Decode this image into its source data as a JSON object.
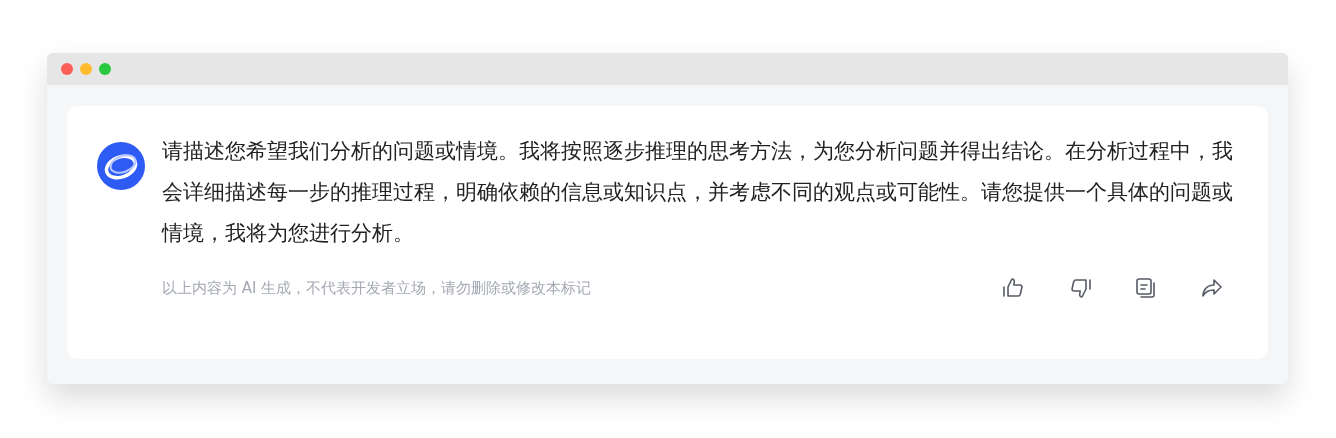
{
  "message": {
    "text": "请描述您希望我们分析的问题或情境。我将按照逐步推理的思考方法，为您分析问题并得出结论。在分析过程中，我会详细描述每一步的推理过程，明确依赖的信息或知识点，并考虑不同的观点或可能性。请您提供一个具体的问题或情境，我将为您进行分析。"
  },
  "disclaimer": "以上内容为 AI 生成，不代表开发者立场，请勿删除或修改本标记",
  "actions": [
    {
      "kind": "like"
    },
    {
      "kind": "dislike"
    },
    {
      "kind": "copy"
    },
    {
      "kind": "share"
    }
  ]
}
